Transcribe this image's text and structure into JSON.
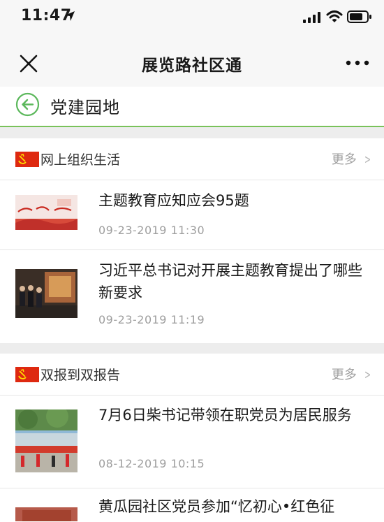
{
  "status_bar": {
    "time": "11:47",
    "icons": [
      "location-arrow-icon",
      "signal-icon",
      "wifi-icon",
      "battery-icon"
    ]
  },
  "nav": {
    "title": "展览路社区通",
    "close_icon": "close-icon",
    "more_icon": "more-dots-icon"
  },
  "page": {
    "title": "党建园地",
    "back_icon": "back-arrow-circle-icon",
    "accent_color": "#79c25a"
  },
  "sections": [
    {
      "title": "网上组织生活",
      "more_label": "更多",
      "articles": [
        {
          "title": "主题教育应知应会95题",
          "date": "09-23-2019 11:30"
        },
        {
          "title": "习近平总书记对开展主题教育提出了哪些新要求",
          "date": "09-23-2019 11:19"
        }
      ]
    },
    {
      "title": "双报到双报告",
      "more_label": "更多",
      "articles": [
        {
          "title": "7月6日柴书记带领在职党员为居民服务",
          "date": "08-12-2019 10:15"
        },
        {
          "title": "黄瓜园社区党员参加“忆初心•红色征",
          "date": ""
        }
      ]
    }
  ],
  "colors": {
    "flag_red": "#de2910",
    "flag_gold": "#ffde00",
    "page_background": "#ededed"
  }
}
